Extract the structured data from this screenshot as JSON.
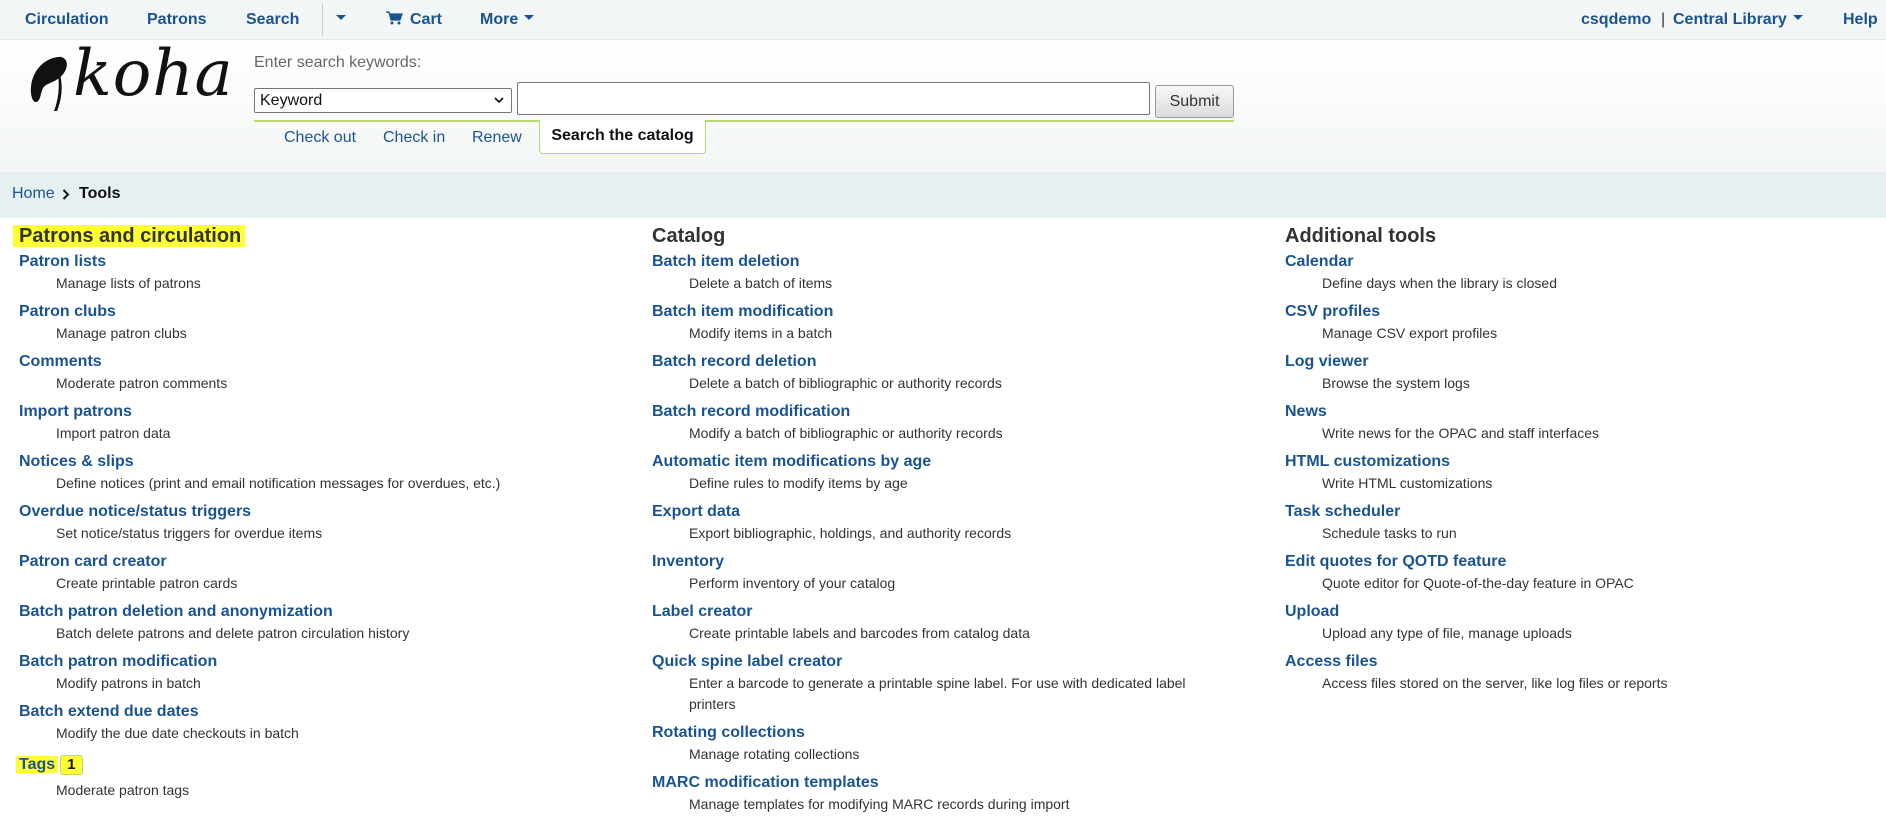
{
  "topnav": {
    "circulation": "Circulation",
    "patrons": "Patrons",
    "search": "Search",
    "cart": "Cart",
    "more": "More",
    "user": "csqdemo",
    "separator": "|",
    "library": "Central Library",
    "help": "Help"
  },
  "logo": {
    "text": "koha"
  },
  "search": {
    "label": "Enter search keywords:",
    "select_value": "Keyword",
    "input_value": "",
    "submit": "Submit"
  },
  "subtabs": {
    "checkout": "Check out",
    "checkin": "Check in",
    "renew": "Renew",
    "catalog": "Search the catalog"
  },
  "breadcrumb": {
    "home": "Home",
    "current": "Tools"
  },
  "columns": {
    "patrons": {
      "title": "Patrons and circulation",
      "tools": [
        {
          "link": "Patron lists",
          "desc": "Manage lists of patrons"
        },
        {
          "link": "Patron clubs",
          "desc": "Manage patron clubs"
        },
        {
          "link": "Comments",
          "desc": "Moderate patron comments"
        },
        {
          "link": "Import patrons",
          "desc": "Import patron data"
        },
        {
          "link": "Notices & slips",
          "desc": "Define notices (print and email notification messages for overdues, etc.)"
        },
        {
          "link": "Overdue notice/status triggers",
          "desc": "Set notice/status triggers for overdue items"
        },
        {
          "link": "Patron card creator",
          "desc": "Create printable patron cards"
        },
        {
          "link": "Batch patron deletion and anonymization",
          "desc": "Batch delete patrons and delete patron circulation history"
        },
        {
          "link": "Batch patron modification",
          "desc": "Modify patrons in batch"
        },
        {
          "link": "Batch extend due dates",
          "desc": "Modify the due date checkouts in batch"
        },
        {
          "link": "Tags",
          "badge": "1",
          "desc": "Moderate patron tags"
        }
      ]
    },
    "catalog": {
      "title": "Catalog",
      "tools": [
        {
          "link": "Batch item deletion",
          "desc": "Delete a batch of items"
        },
        {
          "link": "Batch item modification",
          "desc": "Modify items in a batch"
        },
        {
          "link": "Batch record deletion",
          "desc": "Delete a batch of bibliographic or authority records"
        },
        {
          "link": "Batch record modification",
          "desc": "Modify a batch of bibliographic or authority records"
        },
        {
          "link": "Automatic item modifications by age",
          "desc": "Define rules to modify items by age"
        },
        {
          "link": "Export data",
          "desc": "Export bibliographic, holdings, and authority records"
        },
        {
          "link": "Inventory",
          "desc": "Perform inventory of your catalog"
        },
        {
          "link": "Label creator",
          "desc": "Create printable labels and barcodes from catalog data"
        },
        {
          "link": "Quick spine label creator",
          "desc": "Enter a barcode to generate a printable spine label. For use with dedicated label printers"
        },
        {
          "link": "Rotating collections",
          "desc": "Manage rotating collections"
        },
        {
          "link": "MARC modification templates",
          "desc": "Manage templates for modifying MARC records during import"
        }
      ]
    },
    "additional": {
      "title": "Additional tools",
      "tools": [
        {
          "link": "Calendar",
          "desc": "Define days when the library is closed"
        },
        {
          "link": "CSV profiles",
          "desc": "Manage CSV export profiles"
        },
        {
          "link": "Log viewer",
          "desc": "Browse the system logs"
        },
        {
          "link": "News",
          "desc": "Write news for the OPAC and staff interfaces"
        },
        {
          "link": "HTML customizations",
          "desc": "Write HTML customizations"
        },
        {
          "link": "Task scheduler",
          "desc": "Schedule tasks to run"
        },
        {
          "link": "Edit quotes for QOTD feature",
          "desc": "Quote editor for Quote-of-the-day feature in OPAC"
        },
        {
          "link": "Upload",
          "desc": "Upload any type of file, manage uploads"
        },
        {
          "link": "Access files",
          "desc": "Access files stored on the server, like log files or reports"
        }
      ]
    }
  }
}
